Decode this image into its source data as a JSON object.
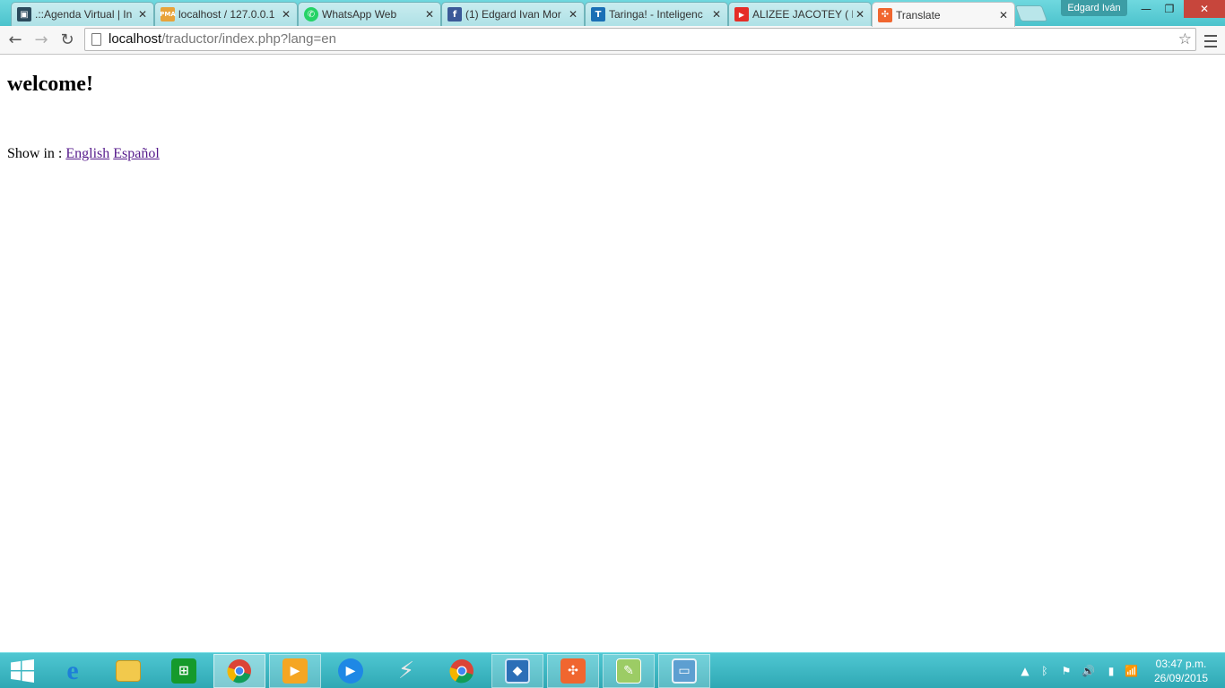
{
  "browser": {
    "tabs": [
      {
        "title": ".::Agenda Virtual | In",
        "favicon": "agenda-icon",
        "color": "#2b4a5c",
        "active": false
      },
      {
        "title": "localhost / 127.0.0.1",
        "favicon": "phpmyadmin-icon",
        "color": "#e8a33a",
        "active": false
      },
      {
        "title": "WhatsApp Web",
        "favicon": "whatsapp-icon",
        "color": "#25d366",
        "active": false
      },
      {
        "title": "(1) Edgard Ivan Mor",
        "favicon": "facebook-icon",
        "color": "#3b5998",
        "active": false
      },
      {
        "title": "Taringa! - Inteligenc",
        "favicon": "taringa-icon",
        "color": "#1a6fb5",
        "active": false
      },
      {
        "title": "ALIZEE JACOTEY ( L",
        "favicon": "youtube-icon",
        "color": "#e52d27",
        "active": false
      },
      {
        "title": "Translate",
        "favicon": "xampp-icon",
        "color": "#f0662f",
        "active": true
      }
    ],
    "profile_name": "Edgard Iván",
    "url_host": "localhost",
    "url_path": "/traductor/index.php?lang=en"
  },
  "page": {
    "heading": "welcome!",
    "show_in_label": "Show in :",
    "links": [
      {
        "label": "English"
      },
      {
        "label": "Español"
      }
    ]
  },
  "taskbar": {
    "apps": [
      {
        "name": "start",
        "icon": "windows-logo-icon"
      },
      {
        "name": "internet-explorer",
        "icon": "internet-explorer-icon"
      },
      {
        "name": "file-explorer",
        "icon": "folder-icon"
      },
      {
        "name": "store",
        "icon": "store-icon"
      },
      {
        "name": "chrome-running",
        "icon": "chrome-icon"
      },
      {
        "name": "media-player",
        "icon": "video-player-icon"
      },
      {
        "name": "windows-media-player",
        "icon": "play-icon"
      },
      {
        "name": "visual-studio",
        "icon": "visual-studio-icon"
      },
      {
        "name": "chrome",
        "icon": "chrome-icon"
      },
      {
        "name": "virtualbox",
        "icon": "virtualbox-icon"
      },
      {
        "name": "xampp",
        "icon": "xampp-icon"
      },
      {
        "name": "notepad-plus-plus",
        "icon": "notepad-icon"
      },
      {
        "name": "photo-viewer",
        "icon": "image-icon"
      }
    ],
    "clock_time": "03:47 p.m.",
    "clock_date": "26/09/2015"
  }
}
